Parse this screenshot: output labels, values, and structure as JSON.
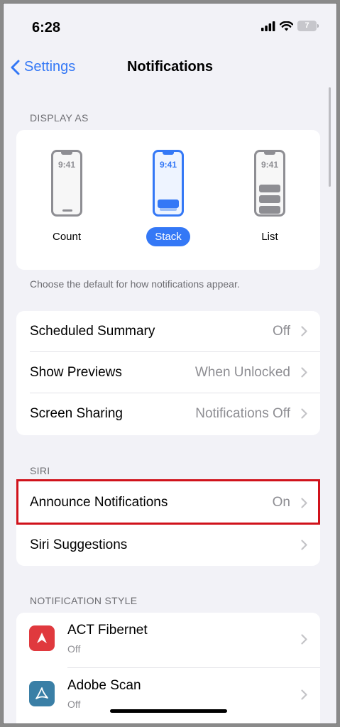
{
  "status_bar": {
    "time": "6:28",
    "battery": "7"
  },
  "nav": {
    "back_label": "Settings",
    "title": "Notifications"
  },
  "display_as": {
    "header": "DISPLAY AS",
    "options": [
      {
        "label": "Count",
        "phone_time": "9:41",
        "selected": false
      },
      {
        "label": "Stack",
        "phone_time": "9:41",
        "selected": true
      },
      {
        "label": "List",
        "phone_time": "9:41",
        "selected": false
      }
    ],
    "footer": "Choose the default for how notifications appear."
  },
  "general": [
    {
      "label": "Scheduled Summary",
      "value": "Off"
    },
    {
      "label": "Show Previews",
      "value": "When Unlocked"
    },
    {
      "label": "Screen Sharing",
      "value": "Notifications Off"
    }
  ],
  "siri": {
    "header": "SIRI",
    "rows": [
      {
        "label": "Announce Notifications",
        "value": "On"
      },
      {
        "label": "Siri Suggestions",
        "value": ""
      }
    ]
  },
  "notification_style": {
    "header": "NOTIFICATION STYLE",
    "apps": [
      {
        "name": "ACT Fibernet",
        "status": "Off",
        "icon": "act-fibernet-icon",
        "color": "#e0393e"
      },
      {
        "name": "Adobe Scan",
        "status": "Off",
        "icon": "adobe-scan-icon",
        "color": "#3a7fa6"
      }
    ]
  },
  "colors": {
    "accent": "#3478f6",
    "highlight": "#d0121b",
    "background": "#f2f2f7"
  }
}
